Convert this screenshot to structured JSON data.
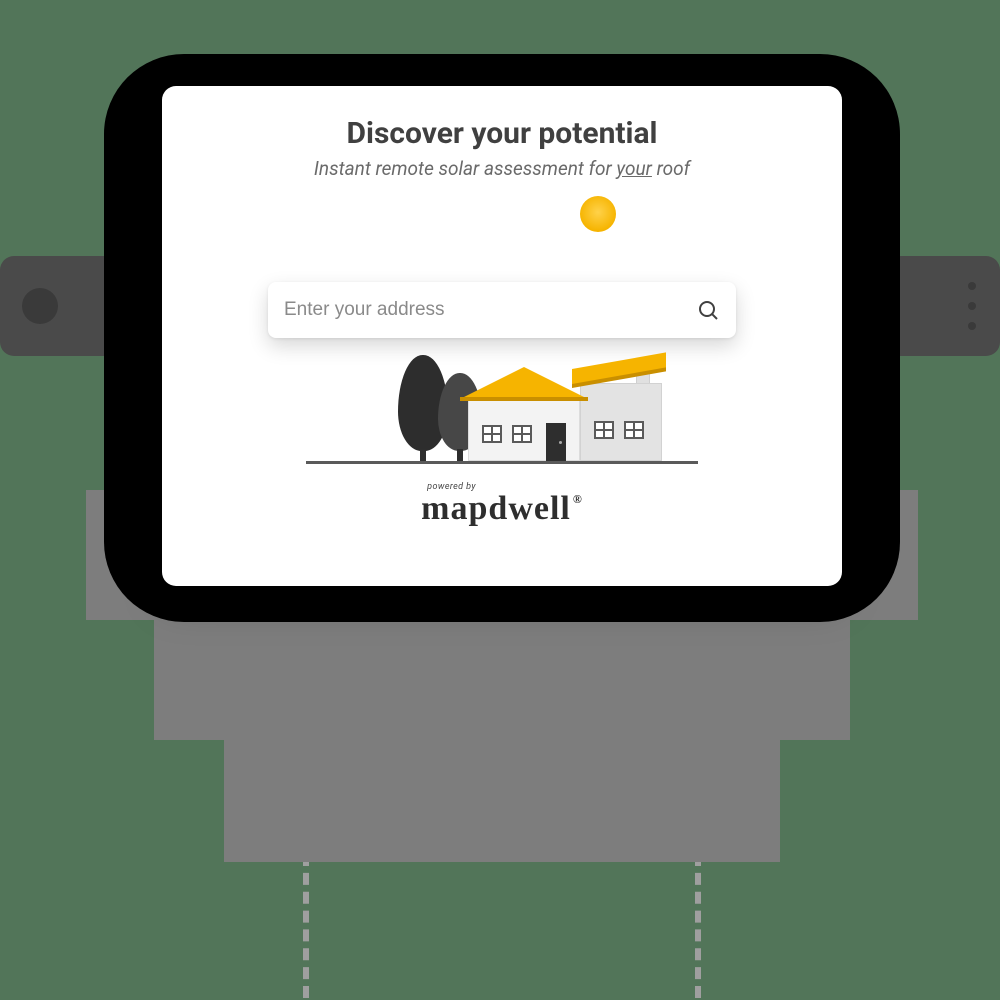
{
  "card": {
    "title": "Discover your potential",
    "subtitle_pre": "Instant remote solar assessment for ",
    "subtitle_em": "your",
    "subtitle_post": " roof"
  },
  "search": {
    "placeholder": "Enter your address",
    "value": ""
  },
  "branding": {
    "powered_by": "powered by",
    "brand_name": "mapdwell",
    "registered": "®"
  }
}
